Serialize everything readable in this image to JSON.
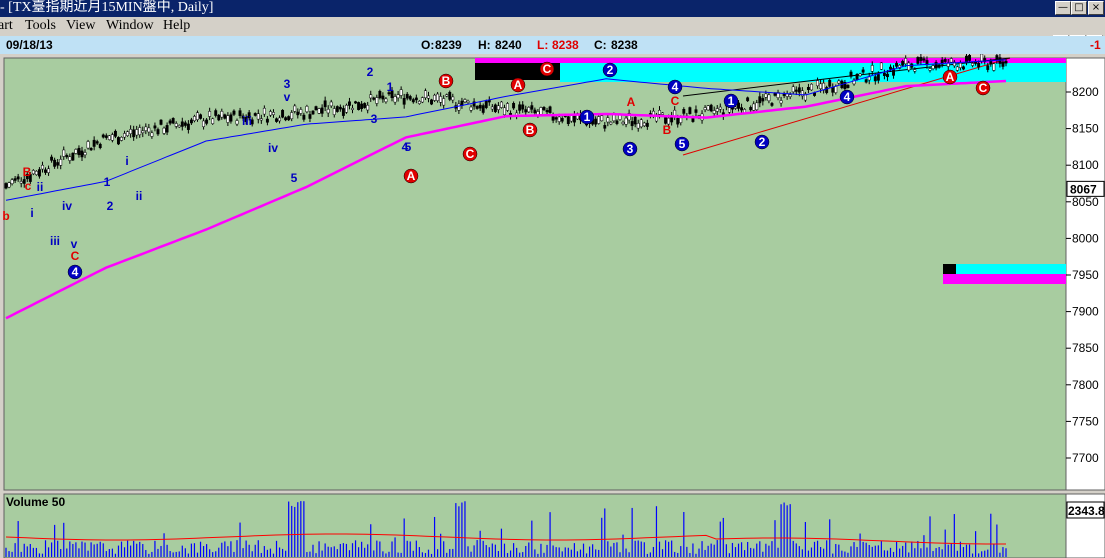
{
  "window": {
    "title": "- [TX臺指期近月15MIN盤中, Daily]",
    "minimize_icon": "minimize-icon",
    "maximize_icon": "restore-icon",
    "close_icon": "close-icon"
  },
  "menu": {
    "items": [
      "art",
      "Tools",
      "View",
      "Window",
      "Help"
    ]
  },
  "info": {
    "date": "09/18/13",
    "open_label": "O:",
    "open": "8239",
    "high_label": "H:",
    "high": "8240",
    "low_label": "L:",
    "low": "8238",
    "close_label": "C:",
    "close": "8238",
    "change": "-1"
  },
  "colors": {
    "chart_bg": "#a8cca0",
    "ma_long": "#ff00ff",
    "ma_short": "#0000ff",
    "wave_blue": "#0000c0",
    "wave_red": "#e00000",
    "cyan_zone": "#00ffff",
    "volume_ma": "#ff0000"
  },
  "chart_data": [
    {
      "type": "line",
      "panel": "price",
      "ylim": [
        7650,
        8290
      ],
      "yticks": [
        7700,
        7750,
        7800,
        7850,
        7900,
        7950,
        8000,
        8050,
        8100,
        8150,
        8200
      ],
      "current_price_label": "8067",
      "x": [
        0,
        10,
        20,
        30,
        40,
        50,
        60,
        70,
        80,
        90,
        100
      ],
      "series": [
        {
          "values": [
            8072,
            8137,
            8163,
            8172,
            8195,
            8177,
            8158,
            8170,
            8200,
            8237,
            8240
          ]
        },
        {
          "values": [
            8052,
            8078,
            8133,
            8156,
            8166,
            8194,
            8218,
            8205,
            8196,
            8236,
            8244
          ]
        },
        {
          "values": [
            7891,
            7960,
            8012,
            8070,
            8138,
            8167,
            8170,
            8165,
            8180,
            8208,
            8215
          ]
        }
      ],
      "wave_labels": [
        {
          "text": "b",
          "color": "red"
        },
        {
          "text": "B",
          "color": "red"
        },
        {
          "text": "c",
          "color": "red"
        },
        {
          "text": "ii",
          "color": "blue"
        },
        {
          "text": "i",
          "color": "blue"
        },
        {
          "text": "iii",
          "color": "blue"
        },
        {
          "text": "iv",
          "color": "blue"
        },
        {
          "text": "v",
          "color": "blue"
        },
        {
          "text": "C",
          "color": "red"
        },
        {
          "text": "4",
          "color": "blue",
          "circled": true
        },
        {
          "text": "1",
          "color": "blue"
        },
        {
          "text": "2",
          "color": "blue"
        },
        {
          "text": "i",
          "color": "blue"
        },
        {
          "text": "ii",
          "color": "blue"
        },
        {
          "text": "iii",
          "color": "blue"
        },
        {
          "text": "iv",
          "color": "blue"
        },
        {
          "text": "4",
          "color": "blue"
        },
        {
          "text": "3",
          "color": "blue"
        },
        {
          "text": "v",
          "color": "blue"
        },
        {
          "text": "5",
          "color": "blue"
        },
        {
          "text": "2",
          "color": "blue"
        },
        {
          "text": "1",
          "color": "blue"
        },
        {
          "text": "3",
          "color": "blue"
        },
        {
          "text": "5",
          "color": "blue"
        },
        {
          "text": "A",
          "color": "red",
          "circled": true
        },
        {
          "text": "B",
          "color": "red",
          "circled": true
        },
        {
          "text": "C",
          "color": "red",
          "circled": true
        },
        {
          "text": "A",
          "color": "red",
          "circled": true
        },
        {
          "text": "B",
          "color": "red",
          "circled": true
        },
        {
          "text": "C",
          "color": "red",
          "circled": true
        },
        {
          "text": "2",
          "color": "blue",
          "circled": true
        },
        {
          "text": "1",
          "color": "blue",
          "circled": true
        },
        {
          "text": "3",
          "color": "blue",
          "circled": true
        },
        {
          "text": "A",
          "color": "red"
        },
        {
          "text": "B",
          "color": "red"
        },
        {
          "text": "C",
          "color": "red"
        },
        {
          "text": "4",
          "color": "blue",
          "circled": true
        },
        {
          "text": "5",
          "color": "blue",
          "circled": true
        },
        {
          "text": "1",
          "color": "blue",
          "circled": true
        },
        {
          "text": "2",
          "color": "blue",
          "circled": true
        },
        {
          "text": "4",
          "color": "blue",
          "circled": true
        },
        {
          "text": "A",
          "color": "red",
          "circled": true
        },
        {
          "text": "C",
          "color": "red",
          "circled": true
        }
      ]
    },
    {
      "type": "bar",
      "panel": "volume",
      "title": "Volume 50",
      "current_value_label": "2343.8"
    }
  ]
}
